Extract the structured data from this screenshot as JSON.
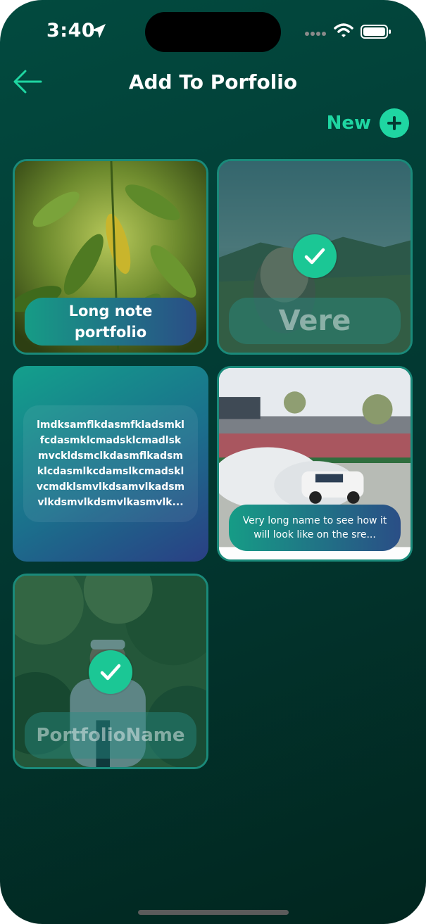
{
  "status_bar": {
    "time": "3:40"
  },
  "header": {
    "title": "Add To Porfolio",
    "new_label": "New"
  },
  "portfolios": [
    {
      "name": "Long note portfolio",
      "selected": false,
      "kind": "photo-leaves"
    },
    {
      "name": "Vere",
      "selected": true,
      "kind": "photo-landscape"
    },
    {
      "note": "lmdksamflkdasmfkladsmkl fcdasmklcmadsklcmadlsk mvckldsmclkdasmflkadsm klcdasmlkcdamslkcmadskl vcmdklsmvlkdsamvlkadsm vlkdsmvlkdsmvlkasmvlk...",
      "kind": "text"
    },
    {
      "name": "Very long name to see how it will look like on the sre...",
      "selected": false,
      "kind": "photo-race"
    },
    {
      "name": "PortfolioName",
      "selected": true,
      "kind": "photo-forest"
    }
  ],
  "colors": {
    "accent": "#1fd6a2",
    "check": "#1bc795",
    "background": "#023a33"
  },
  "icons": [
    "back-arrow-icon",
    "plus-icon",
    "checkmark-icon",
    "location-icon",
    "wifi-icon",
    "battery-icon",
    "signal-icon"
  ]
}
